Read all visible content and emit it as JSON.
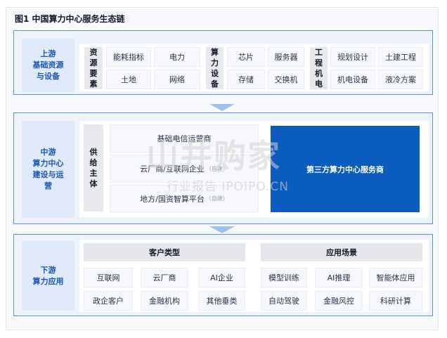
{
  "title": "图1  中国算力中心服务生态链",
  "colors": {
    "border": "#5b8fe3",
    "label_text": "#1e55b3",
    "highlight": "#0b5cbf",
    "arrow": "#9ec0ee"
  },
  "upstream": {
    "label_line1": "上游",
    "label_line2": "基础资源",
    "label_line3": "与设备",
    "resources": {
      "header": "资源要素",
      "items": [
        "能耗指标",
        "电力",
        "土地",
        "网络"
      ]
    },
    "compute": {
      "header": "算力设备",
      "items": [
        "芯片",
        "服务器",
        "存储",
        "交换机"
      ]
    },
    "engineering": {
      "header": "工程机电",
      "items": [
        "规划设计",
        "土建工程",
        "机电设备",
        "液冷方案"
      ]
    }
  },
  "midstream": {
    "label_line1": "中游",
    "label_line2": "算力中心",
    "label_line3": "建设与运",
    "label_line4": "营",
    "supply_header": "供给主体",
    "suppliers": [
      {
        "name": "基础电信运营商",
        "note": ""
      },
      {
        "name": "云厂商/互联网企业",
        "note": "（自建）"
      },
      {
        "name": "地方/国资智算平台",
        "note": "（自建）"
      }
    ],
    "highlight": "第三方算力中心服务商"
  },
  "downstream": {
    "label_line1": "下游",
    "label_line2": "算力应用",
    "customers": {
      "header": "客户类型",
      "items": [
        "互联网",
        "云厂商",
        "AI企业",
        "政企客户",
        "金融机构",
        "其他垂类"
      ]
    },
    "scenarios": {
      "header": "应用场景",
      "items": [
        "模型训练",
        "AI推理",
        "智能体应用",
        "自动驾驶",
        "金融风控",
        "科研计算"
      ]
    }
  },
  "watermark": {
    "main": "山井购家",
    "sub": "行业报告 IPOIPO.CN"
  }
}
